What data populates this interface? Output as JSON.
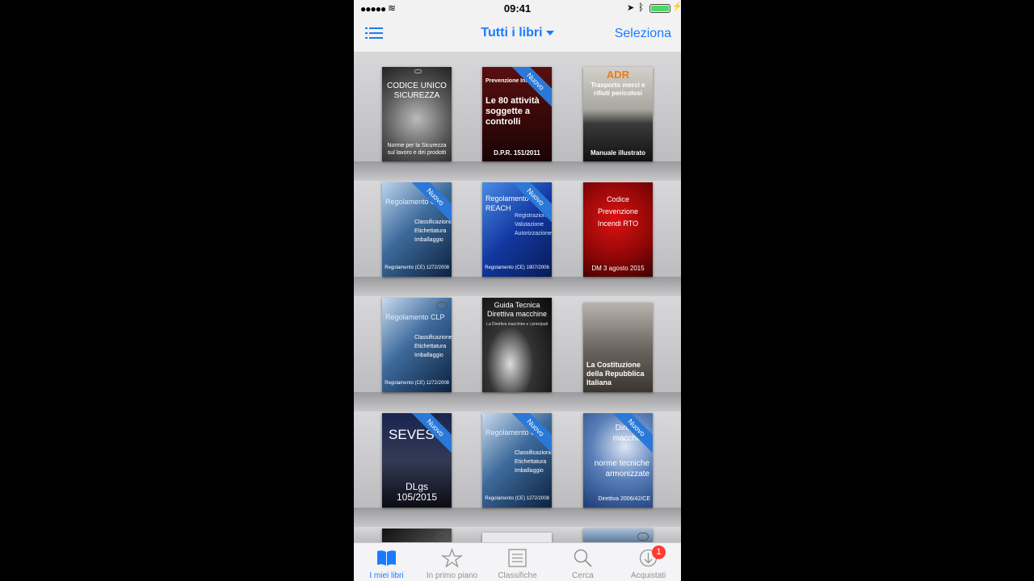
{
  "status_bar": {
    "time": "09:41",
    "signal": "●●●●●",
    "wifi": "≋"
  },
  "nav": {
    "title": "Tutti i libri",
    "select_label": "Seleziona"
  },
  "books": [
    {
      "title": "CODICE UNICO SICUREZZA",
      "footer": "Norme per la Sicurezza sul lavoro e dei prodotti",
      "badge": ""
    },
    {
      "title": "Prevenzione Incendi",
      "subtitle": "Le 80 attività soggette a controlli",
      "footer": "D.P.R. 151/2011",
      "badge": "Nuovo"
    },
    {
      "title": "ADR",
      "subtitle": "Trasporto merci e rifiuti pericolosi",
      "footer": "Manuale illustrato",
      "badge": ""
    },
    {
      "title": "Regolamento CLP",
      "subtitle": "Classificazione Etichettatura Imballaggio",
      "footer": "Regolamento (CE) 1272/2008",
      "badge": "Nuovo"
    },
    {
      "title": "Regolamento REACH",
      "subtitle": "Registrazione Valutazione Autorizzazione",
      "footer": "Regolamento (CE) 1907/2006",
      "badge": "Nuovo"
    },
    {
      "title": "Codice Prevenzione Incendi RTO",
      "footer": "DM 3 agosto 2015",
      "badge": ""
    },
    {
      "title": "Regolamento CLP",
      "subtitle": "Classificazione Etichettatura Imballaggio",
      "footer": "Regolamento (CE) 1272/2008",
      "badge": ""
    },
    {
      "title": "Guida Tecnica Direttiva macchine",
      "subtitle": "La Direttiva macchine e i principali",
      "footer": "",
      "badge": ""
    },
    {
      "title": "La Costituzione della Repubblica Italiana",
      "footer": "",
      "badge": ""
    },
    {
      "title": "SEVESO",
      "footer": "DLgs 105/2015",
      "badge": "Nuovo"
    },
    {
      "title": "Regolamento CLP",
      "subtitle": "Classificazione Etichettatura Imballaggio",
      "footer": "Regolamento (CE) 1272/2008",
      "badge": "Nuovo"
    },
    {
      "title": "Direttiva macchine",
      "subtitle": "norme tecniche armonizzate",
      "footer": "Direttiva 2006/42/CE",
      "badge": "Nuovo"
    }
  ],
  "tabs": [
    {
      "label": "I miei libri",
      "icon": "book-open-icon",
      "active": true
    },
    {
      "label": "In primo piano",
      "icon": "star-icon"
    },
    {
      "label": "Classifiche",
      "icon": "list-icon"
    },
    {
      "label": "Cerca",
      "icon": "search-icon"
    },
    {
      "label": "Acquistati",
      "icon": "download-icon",
      "badge": "1"
    }
  ],
  "colors": {
    "accent": "#1a7bff",
    "ribbon": "#2a78d8",
    "badge": "#ff3b30"
  }
}
